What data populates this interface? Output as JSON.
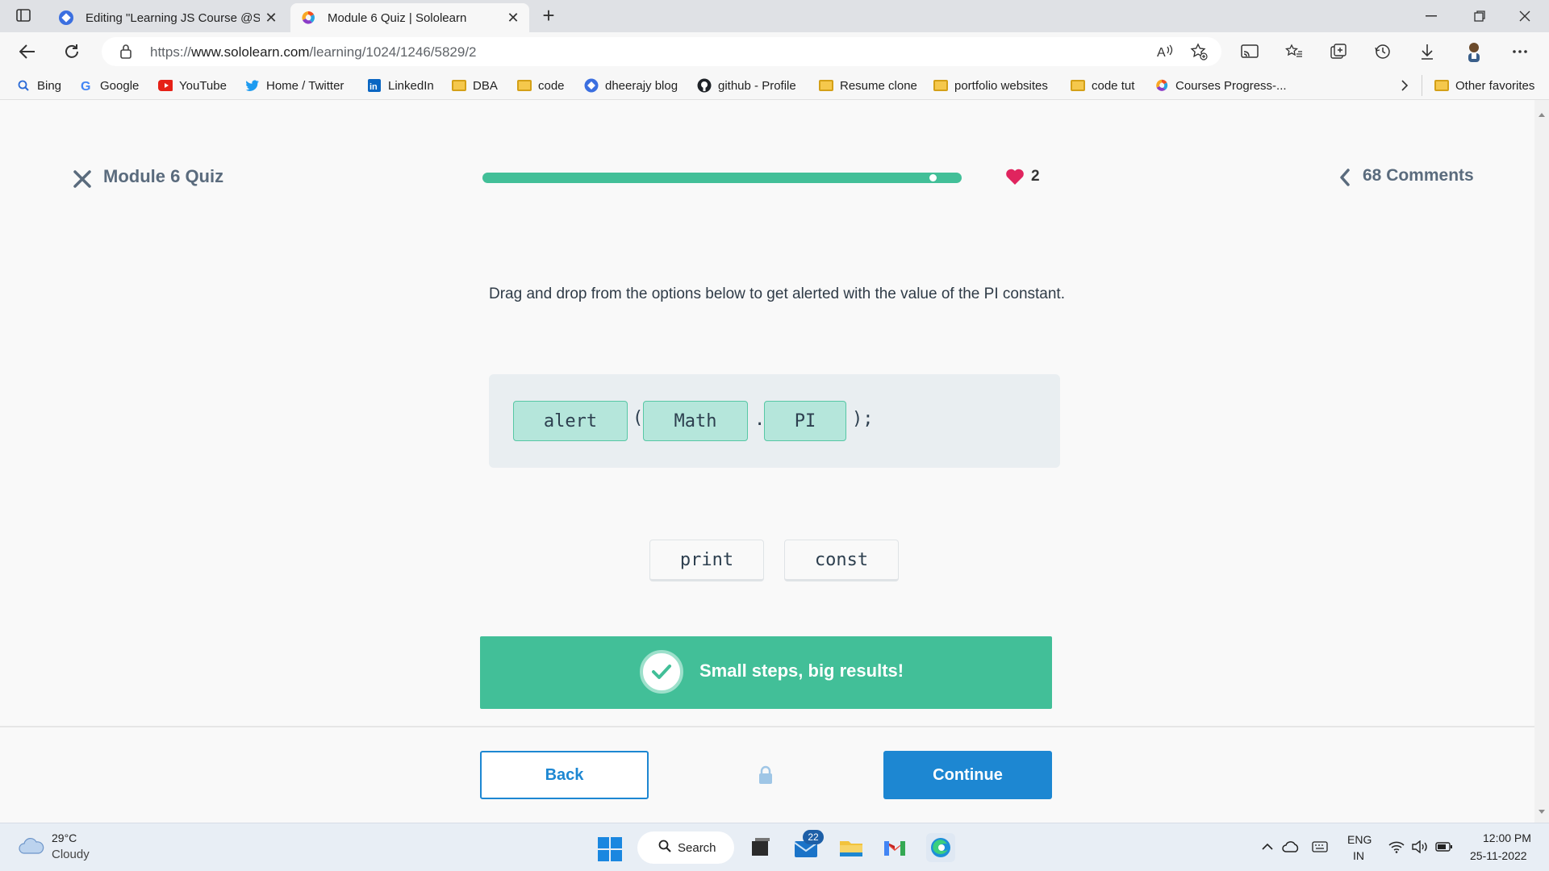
{
  "browser": {
    "tabs": [
      {
        "title": "Editing \"Learning JS Course @So",
        "active": false
      },
      {
        "title": "Module 6 Quiz | Sololearn",
        "active": true
      }
    ],
    "url": {
      "prefix": "https://",
      "host": "www.sololearn.com",
      "path": "/learning/1024/1246/5829/2"
    },
    "favorites": [
      {
        "label": "Bing",
        "icon": "bing-search-icon"
      },
      {
        "label": "Google",
        "icon": "google-icon"
      },
      {
        "label": "YouTube",
        "icon": "youtube-icon"
      },
      {
        "label": "Home / Twitter",
        "icon": "twitter-icon"
      },
      {
        "label": "LinkedIn",
        "icon": "linkedin-icon"
      },
      {
        "label": "DBA",
        "icon": "folder-icon"
      },
      {
        "label": "code",
        "icon": "folder-icon"
      },
      {
        "label": "dheerajy blog",
        "icon": "blog-icon"
      },
      {
        "label": "github - Profile",
        "icon": "github-icon"
      },
      {
        "label": "Resume clone",
        "icon": "folder-icon"
      },
      {
        "label": "portfolio websites",
        "icon": "folder-icon"
      },
      {
        "label": "code tut",
        "icon": "folder-icon"
      },
      {
        "label": "Courses Progress-...",
        "icon": "sololearn-icon"
      },
      {
        "label": "Other favorites",
        "icon": "folder-icon"
      }
    ]
  },
  "quiz": {
    "title": "Module 6 Quiz",
    "progress_fraction": 0.94,
    "lives": "2",
    "comments": "68 Comments",
    "question": "Drag and drop from the options below to get alerted with the value of the PI constant.",
    "answer": {
      "tokens": [
        "alert",
        "Math",
        "PI"
      ],
      "open_paren": "(",
      "dot": ".",
      "close": ");"
    },
    "options": [
      "print",
      "const"
    ],
    "feedback": "Small steps, big results!",
    "back_label": "Back",
    "continue_label": "Continue"
  },
  "taskbar": {
    "weather_temp": "29°C",
    "weather_cond": "Cloudy",
    "search_label": "Search",
    "mail_badge": "22",
    "lang_line1": "ENG",
    "lang_line2": "IN",
    "time": "12:00 PM",
    "date": "25-11-2022"
  },
  "colors": {
    "accent_green": "#42bf98",
    "accent_blue": "#1d87d2",
    "heart_red": "#e0245e"
  }
}
